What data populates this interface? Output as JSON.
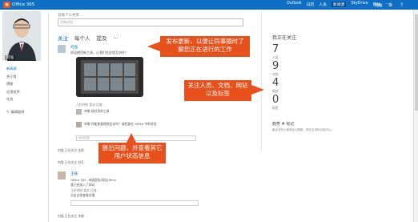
{
  "topbar": {
    "brand": "Office 365",
    "nav": [
      "Outlook",
      "日历",
      "人员",
      "新闻源",
      "SkyDrive",
      "网站",
      "..."
    ],
    "active_nav": "新闻源",
    "user": "何强",
    "settings_icon": "gear-icon",
    "help_icon": "question-icon"
  },
  "profile": {
    "name": "何强",
    "nav": [
      "新闻源",
      "关于我",
      "博客",
      "应用程序",
      "任务"
    ],
    "active_nav": "新闻源",
    "edit_label": "编辑链接"
  },
  "composer": {
    "label": "与每个人共享",
    "placeholder": "开始对话"
  },
  "feed_tabs": [
    "关注",
    "每个人",
    "提及",
    "..."
  ],
  "posts": [
    {
      "author": "何强",
      "text": "欢迎使用新工具，让我们在此相互协作！",
      "meta": "几秒钟前  喜欢  回复  ...",
      "comments": [
        {
          "author": "李娜",
          "text": "很好用的工具"
        },
        {
          "author": "李娜",
          "text": "你能查看视频会议吗？请检查在 Office 中的状态"
        }
      ],
      "reply_placeholder": "添加回复"
    },
    {
      "author": "王辉",
      "sub": "Office 365 , 新建团队网站Office",
      "text": "我已经加入了网站",
      "meta": "几秒钟前  喜欢  回复  ...",
      "comment": "点击这里查看详情"
    }
  ],
  "activity_lines": [
    "何强 正在关注 张燕",
    "何强 正在关注 刘芳"
  ],
  "bottom_line": "何强 正在关注 李娜",
  "following": {
    "title": "我正在关注",
    "stats": [
      {
        "num": "7",
        "label": "人员"
      },
      {
        "num": "9",
        "label": "文档"
      },
      {
        "num": "4",
        "label": "网站"
      },
      {
        "num": "0",
        "label": "标签"
      }
    ]
  },
  "tags": {
    "title": "趋势 # 标记",
    "text": "最近没有人使用标记更新。现在应用标记就可以。"
  },
  "callouts": [
    "发布更新，以便让同事随时了解您正在进行的工作",
    "关注人员、文档、网站以及标签",
    "提出问题，并查看其它用户状态信息"
  ],
  "colors": {
    "topbar": "#0f6fc5",
    "accent": "#0072c6",
    "callout": "#e8501c"
  }
}
